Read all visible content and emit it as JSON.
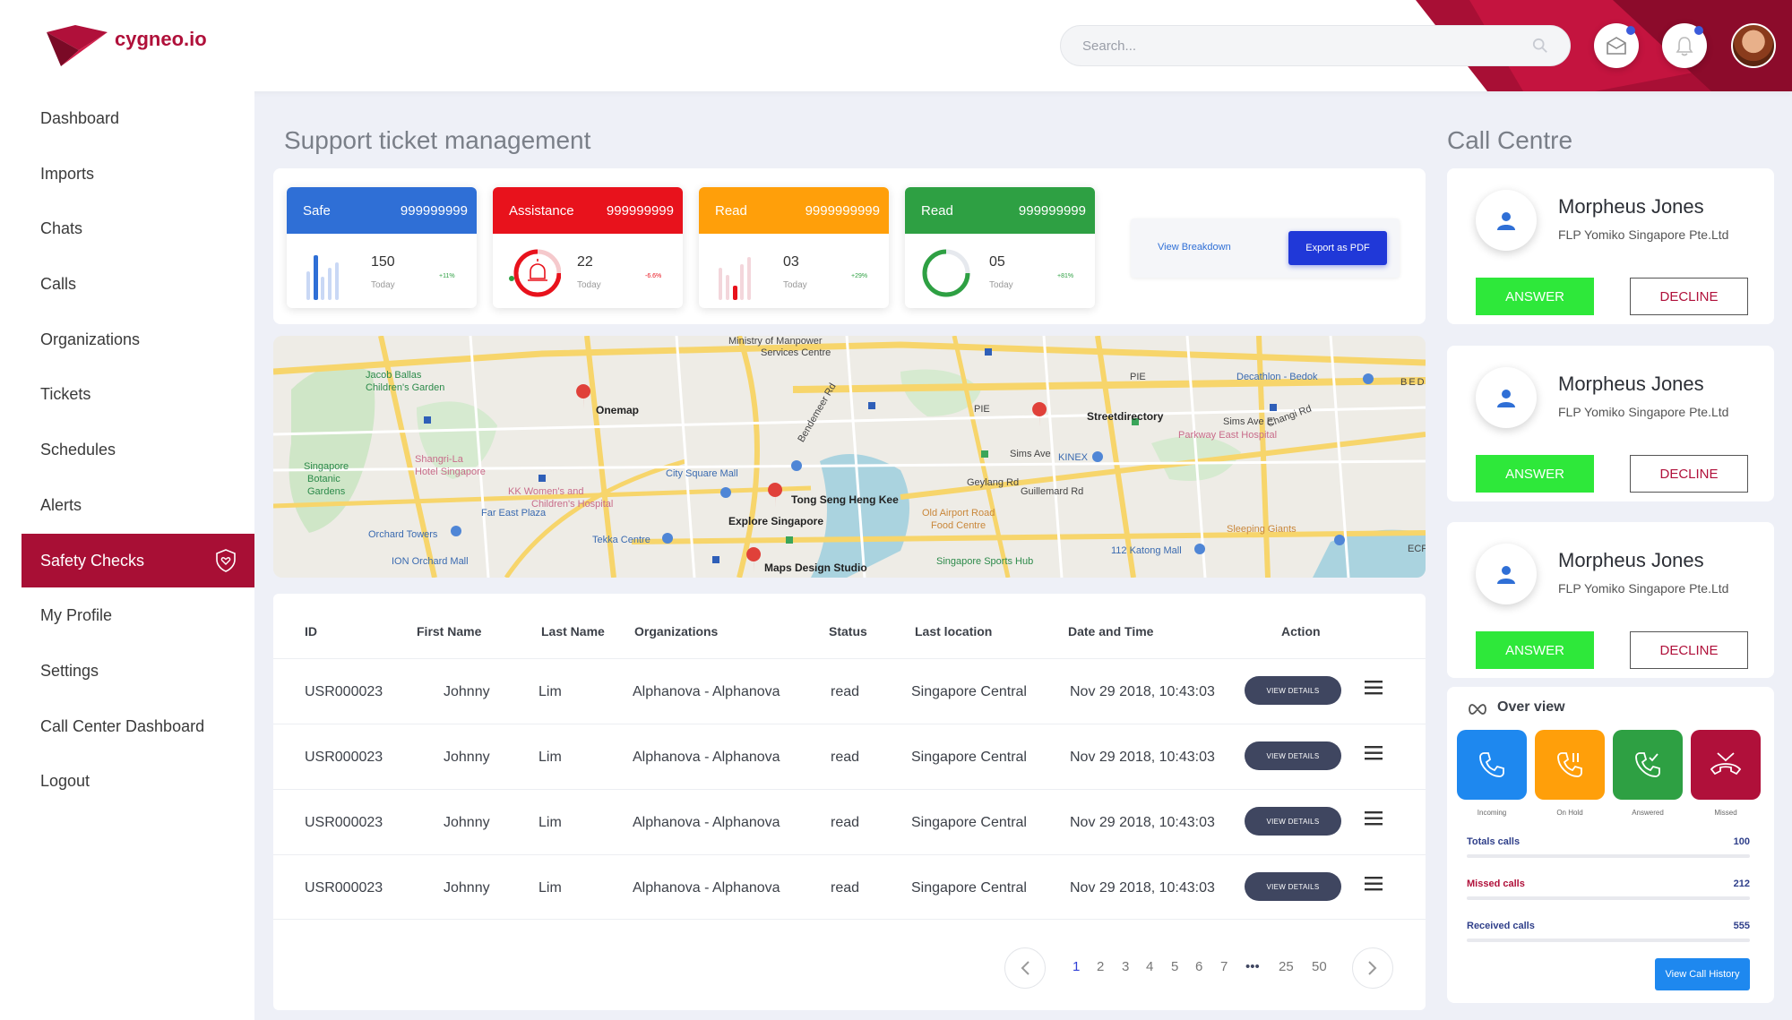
{
  "brand": {
    "name": "cygneo.io",
    "color": "#b0103a"
  },
  "header": {
    "search_placeholder": "Search..."
  },
  "sidebar": {
    "items": [
      {
        "label": "Dashboard"
      },
      {
        "label": "Imports"
      },
      {
        "label": "Chats"
      },
      {
        "label": "Calls"
      },
      {
        "label": "Organizations"
      },
      {
        "label": "Tickets"
      },
      {
        "label": "Schedules"
      },
      {
        "label": "Alerts"
      },
      {
        "label": "Safety Checks",
        "active": true,
        "icon": "shield-heart-icon"
      },
      {
        "label": "My Profile"
      },
      {
        "label": "Settings"
      },
      {
        "label": "Call Center Dashboard"
      },
      {
        "label": "Logout"
      }
    ]
  },
  "page_title": "Support ticket management",
  "stats": [
    {
      "label": "Safe",
      "count": "999999999",
      "value": "150",
      "sub": "Today",
      "trend": "+11%",
      "color": "#2f6fd6"
    },
    {
      "label": "Assistance",
      "count": "999999999",
      "value": "22",
      "sub": "Today",
      "trend": "-6.6%",
      "color": "#e8121c"
    },
    {
      "label": "Read",
      "count": "9999999999",
      "value": "03",
      "sub": "Today",
      "trend": "+29%",
      "color": "#ff9f0a"
    },
    {
      "label": "Read",
      "count": "999999999",
      "value": "05",
      "sub": "Today",
      "trend": "+81%",
      "color": "#2ea043"
    }
  ],
  "actions": {
    "view_breakdown": "View Breakdown",
    "export": "Export as PDF"
  },
  "map": {
    "labels": {
      "jacob": "Jacob Ballas",
      "jacob2": "Children's Garden",
      "onemap": "Onemap",
      "mom": "Ministry of Manpower",
      "mom2": "Services Centre",
      "streetdir": "Streetdirectory",
      "decathlon": "Decathlon - Bedok",
      "parkway": "Parkway East Hospital",
      "sbg": "Singapore",
      "sbg2": "Botanic",
      "sbg3": "Gardens",
      "shangri": "Shangri-La",
      "shangri2": "Hotel Singapore",
      "kk": "KK Women's and",
      "kk2": "Children's Hospital",
      "cityhall": "City Square Mall",
      "tongseng": "Tong Seng Heng Kee",
      "explore": "Explore Singapore",
      "kinex": "KINEX",
      "simsave": "Sims Ave",
      "geylang": "Geylang Rd",
      "guillemard": "Guillemard Rd",
      "oldairport": "Old Airport Road",
      "oldairport2": "Food Centre",
      "sleeping": "Sleeping Giants",
      "fareast": "Far East Plaza",
      "orchard": "Orchard Towers",
      "ion": "ION Orchard Mall",
      "tekka": "Tekka Centre",
      "maps": "Maps Design Studio",
      "sportshub": "Singapore Sports Hub",
      "katong": "112 Katong Mall",
      "bendemeer": "Bendemeer Rd",
      "simsave2": "Sims Ave E",
      "changi": "Changi Rd",
      "pie": "PIE",
      "pie2": "PIE",
      "ecp": "ECP",
      "bedok": "BEDO"
    }
  },
  "table": {
    "headers": [
      "ID",
      "First Name",
      "Last Name",
      "Organizations",
      "Status",
      "Last location",
      "Date and Time",
      "Action"
    ],
    "rows": [
      {
        "id": "USR000023",
        "first": "Johnny",
        "last": "Lim",
        "org": "Alphanova - Alphanova",
        "status": "read",
        "location": "Singapore Central",
        "datetime": "Nov 29 2018, 10:43:03",
        "action": "VIEW DETAILS"
      },
      {
        "id": "USR000023",
        "first": "Johnny",
        "last": "Lim",
        "org": "Alphanova - Alphanova",
        "status": "read",
        "location": "Singapore Central",
        "datetime": "Nov 29 2018, 10:43:03",
        "action": "VIEW DETAILS"
      },
      {
        "id": "USR000023",
        "first": "Johnny",
        "last": "Lim",
        "org": "Alphanova - Alphanova",
        "status": "read",
        "location": "Singapore Central",
        "datetime": "Nov 29 2018, 10:43:03",
        "action": "VIEW DETAILS"
      },
      {
        "id": "USR000023",
        "first": "Johnny",
        "last": "Lim",
        "org": "Alphanova - Alphanova",
        "status": "read",
        "location": "Singapore Central",
        "datetime": "Nov 29 2018, 10:43:03",
        "action": "VIEW DETAILS"
      }
    ],
    "pagination": [
      "1",
      "2",
      "3",
      "4",
      "5",
      "6",
      "7",
      "•••",
      "25",
      "50"
    ],
    "current_page": "1"
  },
  "call_centre": {
    "title": "Call Centre",
    "cards": [
      {
        "name": "Morpheus Jones",
        "org": "FLP Yomiko Singapore Pte.Ltd",
        "answer": "ANSWER",
        "decline": "DECLINE"
      },
      {
        "name": "Morpheus Jones",
        "org": "FLP Yomiko Singapore Pte.Ltd",
        "answer": "ANSWER",
        "decline": "DECLINE"
      },
      {
        "name": "Morpheus Jones",
        "org": "FLP Yomiko Singapore Pte.Ltd",
        "answer": "ANSWER",
        "decline": "DECLINE"
      }
    ],
    "overview": {
      "title": "Over view",
      "tiles": [
        {
          "label": "Incoming",
          "color": "#1e88ef",
          "icon": "phone-icon"
        },
        {
          "label": "On Hold",
          "color": "#ff9f0a",
          "icon": "phone-hold-icon"
        },
        {
          "label": "Answered",
          "color": "#2ea043",
          "icon": "phone-answered-icon"
        },
        {
          "label": "Missed",
          "color": "#b0103a",
          "icon": "phone-missed-icon"
        }
      ],
      "totals": {
        "label": "Totals calls",
        "value": "100"
      },
      "missed": {
        "label": "Missed calls",
        "value": "212"
      },
      "received": {
        "label": "Received calls",
        "value": "555"
      },
      "history_button": "View Call History"
    }
  }
}
